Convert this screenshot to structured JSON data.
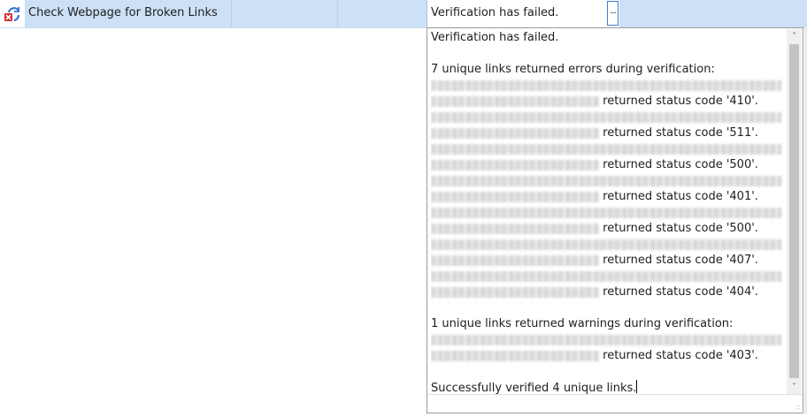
{
  "row": {
    "task_name": "Check Webpage for Broken Links",
    "result_value": "Verification has failed.",
    "ellipsis_label": "...",
    "status_icon": "refresh-error-icon"
  },
  "memo": {
    "lines": [
      "Verification has failed.",
      "",
      "7 unique links returned errors during verification:",
      "",
      "returned status code '410'.",
      "",
      "returned status code '511'.",
      "",
      "returned status code '500'.",
      "",
      "returned status code '401'.",
      "",
      "returned status code '500'.",
      "",
      "returned status code '407'.",
      "",
      "returned status code '404'.",
      "",
      "1 unique links returned warnings during verification:",
      "",
      "returned status code '403'.",
      "",
      "Successfully verified 4 unique links."
    ],
    "scroll_up": "˄",
    "scroll_down": "˅",
    "grip": "∷"
  },
  "colors": {
    "selection": "#cce0f6",
    "error_icon": "#d92b2b",
    "refresh_icon": "#2c6fd1"
  }
}
